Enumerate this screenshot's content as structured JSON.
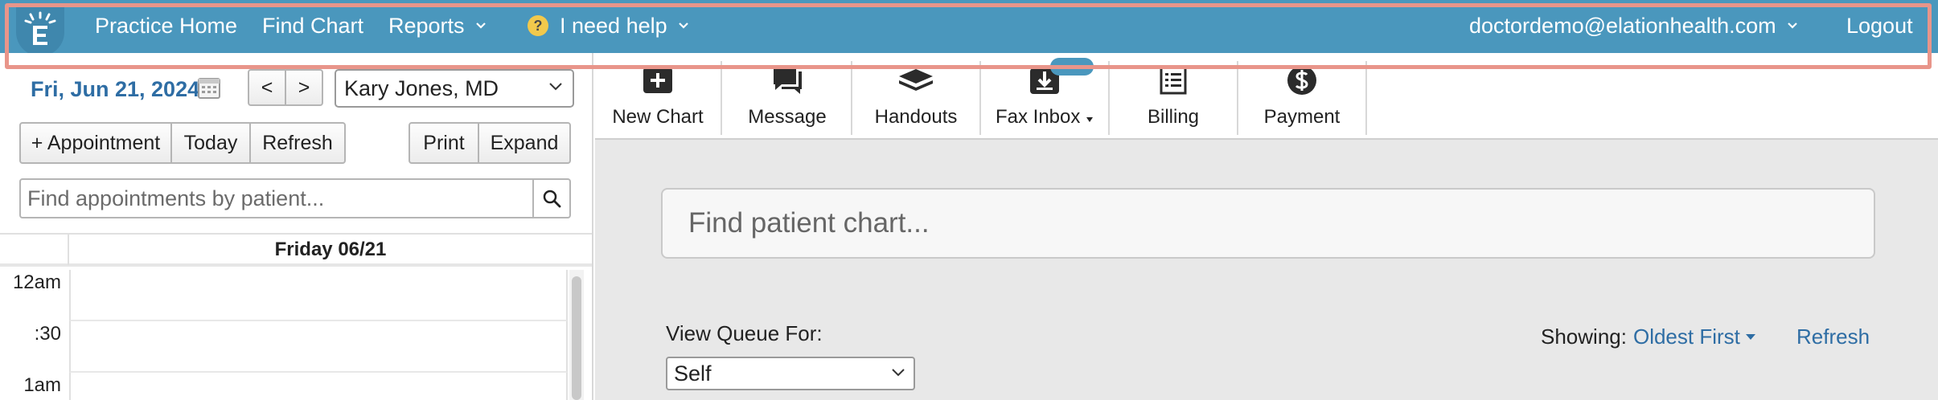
{
  "header": {
    "nav": {
      "practice_home": "Practice Home",
      "find_chart": "Find Chart",
      "reports": "Reports",
      "help": "I need help",
      "help_badge": "?"
    },
    "user_email": "doctordemo@elationhealth.com",
    "logout": "Logout",
    "colors": {
      "bar": "#4a97bd",
      "highlight_outline": "#e8958a"
    }
  },
  "scheduler": {
    "date_label": "Fri, Jun 21, 2024",
    "prev": "<",
    "next": ">",
    "provider": "Kary Jones, MD",
    "buttons": {
      "appointment": "+ Appointment",
      "today": "Today",
      "refresh": "Refresh",
      "print": "Print",
      "expand": "Expand"
    },
    "search_placeholder": "Find appointments by patient...",
    "day_title": "Friday 06/21",
    "time_slots": [
      "12am",
      ":30",
      "1am"
    ]
  },
  "toolbar": {
    "new_chart": "New Chart",
    "message": "Message",
    "handouts": "Handouts",
    "fax_inbox": "Fax Inbox",
    "billing": "Billing",
    "payment": "Payment"
  },
  "main": {
    "chart_search_placeholder": "Find patient chart...",
    "view_queue_label": "View Queue For:",
    "queue_value": "Self",
    "showing_label": "Showing:",
    "sort_value": "Oldest First",
    "refresh": "Refresh"
  }
}
